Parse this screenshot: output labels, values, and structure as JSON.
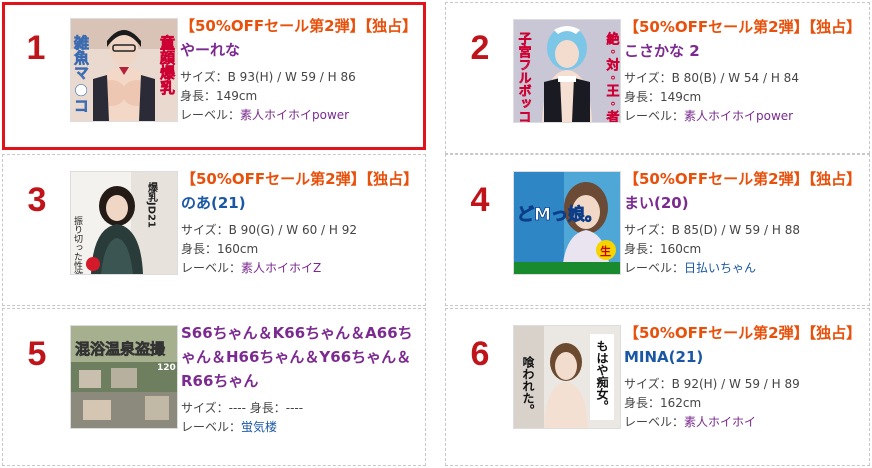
{
  "items": [
    {
      "rank": "1",
      "sale": "【50%OFFセール第2弾】【独占】",
      "name": "やーれな",
      "size": "サイズ：B 93(H) / W 59 / H 86",
      "height": "身長：149cm",
      "label_prefix": "レーベル：",
      "label": "素人ホイホイpower",
      "thumb_text": [
        "雑魚マ●コ",
        "童顔爆乳"
      ]
    },
    {
      "rank": "2",
      "sale": "【50%OFFセール第2弾】【独占】",
      "name": "こさかな 2",
      "size": "サイズ：B 80(B) / W 54 / H 84",
      "height": "身長：149cm",
      "label_prefix": "レーベル：",
      "label": "素人ホイホイpower",
      "thumb_text": [
        "子宮フルボッコ",
        "絶・対・王・者"
      ]
    },
    {
      "rank": "3",
      "sale": "【50%OFFセール第2弾】【独占】",
      "name": "のあ(21)",
      "size": "サイズ：B 90(G) / W 60 / H 92",
      "height": "身長：160cm",
      "label_prefix": "レーベル：",
      "label": "素人ホイホイZ",
      "thumb_text": [
        "爆乳JD21",
        "振り切った性欲"
      ]
    },
    {
      "rank": "4",
      "sale": "【50%OFFセール第2弾】【独占】",
      "name": "まい(20)",
      "size": "サイズ：B 85(D) / W 59 / H 88",
      "height": "身長：160cm",
      "label_prefix": "レーベル：",
      "label": "日払いちゃん",
      "thumb_text": [
        "どMっ娘。",
        "生"
      ]
    },
    {
      "rank": "5",
      "title": "S66ちゃん＆K66ちゃん＆A66ちゃん＆H66ちゃん＆Y66ちゃん＆R66ちゃん",
      "size": "サイズ：---- 身長：----",
      "label_prefix": "レーベル：",
      "label": "蛍気楼",
      "thumb_text": [
        "混浴温泉盗撮",
        "120"
      ]
    },
    {
      "rank": "6",
      "sale": "【50%OFFセール第2弾】【独占】",
      "name": "MINA(21)",
      "size": "サイズ：B 92(H) / W 59 / H 89",
      "height": "身長：162cm",
      "label_prefix": "レーベル：",
      "label": "素人ホイホイ",
      "thumb_text": [
        "もはや痴女。",
        "喰われた。"
      ]
    }
  ],
  "colors": {
    "rank": "#c0141b",
    "sale": "#e8500b",
    "name_purple": "#7b2a90",
    "name_blue": "#1a57a5",
    "highlight_border": "#e0131d"
  }
}
